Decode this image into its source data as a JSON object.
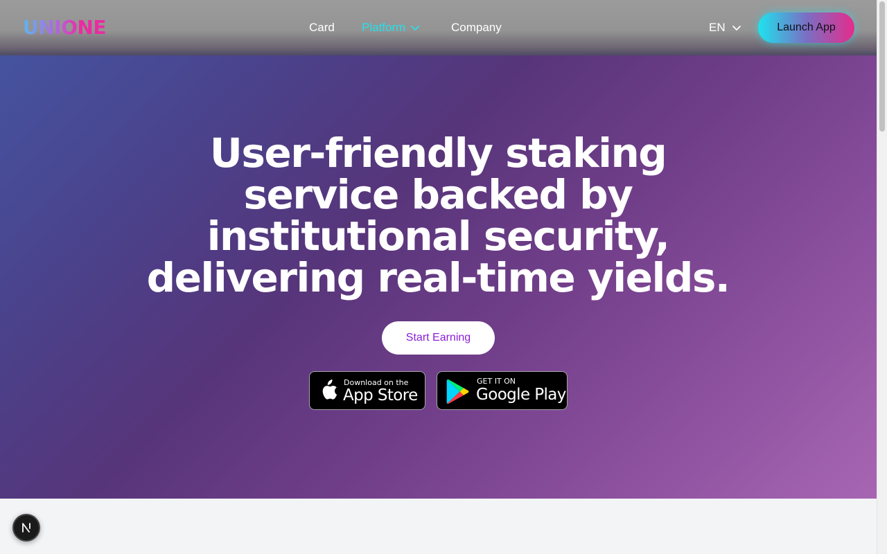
{
  "header": {
    "logo_text": "UNIONE",
    "nav": [
      {
        "label": "Card"
      },
      {
        "label": "Platform",
        "has_dropdown": true,
        "active": true
      },
      {
        "label": "Company"
      }
    ],
    "language": "EN",
    "launch_label": "Launch App"
  },
  "hero": {
    "title": "User-friendly staking service backed by institutional security, delivering real-time yields.",
    "cta_label": "Start Earning",
    "app_store": {
      "small": "Download on the",
      "big": "App Store"
    },
    "google_play": {
      "small": "GET IT ON",
      "big": "Google Play"
    }
  },
  "dev_badge": {
    "letter": "N"
  },
  "colors": {
    "active_nav": "#25e0ea",
    "cta_text": "#8a1dd6",
    "hero_gradient_start": "#45539f",
    "hero_gradient_end": "#a766b2",
    "launch_gradient_start": "#1ee3ee",
    "launch_gradient_end": "#e52c8c"
  },
  "icons": [
    "chevron-down-icon",
    "apple-icon",
    "google-play-icon",
    "nextjs-icon"
  ]
}
